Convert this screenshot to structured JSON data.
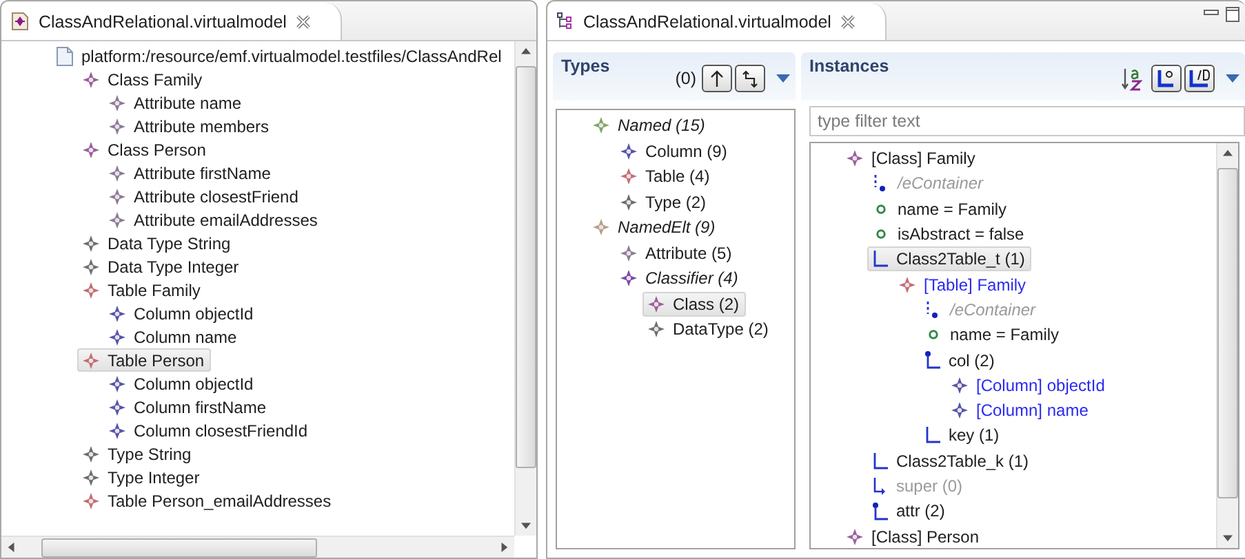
{
  "model_editor": {
    "tab": {
      "title": "ClassAndRelational.virtualmodel"
    },
    "tree": [
      {
        "label": "platform:/resource/emf.virtualmodel.testfiles/ClassAndRel",
        "kind": "resource",
        "selected": false,
        "children": [
          {
            "label": "Class Family",
            "kind": "class",
            "selected": false,
            "children": [
              {
                "label": "Attribute name",
                "kind": "attribute",
                "selected": false
              },
              {
                "label": "Attribute members",
                "kind": "attribute",
                "selected": false
              }
            ]
          },
          {
            "label": "Class Person",
            "kind": "class",
            "selected": false,
            "children": [
              {
                "label": "Attribute firstName",
                "kind": "attribute",
                "selected": false
              },
              {
                "label": "Attribute closestFriend",
                "kind": "attribute",
                "selected": false
              },
              {
                "label": "Attribute emailAddresses",
                "kind": "attribute",
                "selected": false
              }
            ]
          },
          {
            "label": "Data Type String",
            "kind": "datatype",
            "selected": false
          },
          {
            "label": "Data Type Integer",
            "kind": "datatype",
            "selected": false
          },
          {
            "label": "Table Family",
            "kind": "table",
            "selected": false,
            "children": [
              {
                "label": "Column objectId",
                "kind": "column",
                "selected": false
              },
              {
                "label": "Column name",
                "kind": "column",
                "selected": false
              }
            ]
          },
          {
            "label": "Table Person",
            "kind": "table",
            "selected": true,
            "children": [
              {
                "label": "Column objectId",
                "kind": "column",
                "selected": false
              },
              {
                "label": "Column firstName",
                "kind": "column",
                "selected": false
              },
              {
                "label": "Column closestFriendId",
                "kind": "column",
                "selected": false
              }
            ]
          },
          {
            "label": "Type String",
            "kind": "type",
            "selected": false
          },
          {
            "label": "Type Integer",
            "kind": "type",
            "selected": false
          },
          {
            "label": "Table Person_emailAddresses",
            "kind": "table",
            "selected": false
          }
        ]
      }
    ]
  },
  "virtual_model_view": {
    "tab": {
      "title": "ClassAndRelational.virtualmodel"
    },
    "types": {
      "title": "Types",
      "count": "(0)",
      "tree": [
        {
          "label": "Named (15)",
          "kind": "named",
          "abstract": true,
          "selected": false,
          "children": [
            {
              "label": "Column (9)",
              "kind": "column",
              "abstract": false,
              "selected": false
            },
            {
              "label": "Table (4)",
              "kind": "table",
              "abstract": false,
              "selected": false
            },
            {
              "label": "Type (2)",
              "kind": "type",
              "abstract": false,
              "selected": false
            }
          ]
        },
        {
          "label": "NamedElt (9)",
          "kind": "namedelt",
          "abstract": true,
          "selected": false,
          "children": [
            {
              "label": "Attribute (5)",
              "kind": "attribute",
              "abstract": false,
              "selected": false
            },
            {
              "label": "Classifier (4)",
              "kind": "classifier",
              "abstract": true,
              "selected": false,
              "children": [
                {
                  "label": "Class (2)",
                  "kind": "class",
                  "abstract": false,
                  "selected": true
                },
                {
                  "label": "DataType (2)",
                  "kind": "datatype",
                  "abstract": false,
                  "selected": false
                }
              ]
            }
          ]
        }
      ]
    },
    "instances": {
      "title": "Instances",
      "filter": {
        "placeholder": "type filter text"
      },
      "tree": [
        {
          "label": "[Class] Family",
          "kind": "class",
          "linked": false,
          "selected": false,
          "children": [
            {
              "label": "/eContainer",
              "kind": "derived",
              "selected": false
            },
            {
              "label": "name = Family",
              "kind": "attribute-value",
              "selected": false
            },
            {
              "label": "isAbstract = false",
              "kind": "attribute-value",
              "selected": false
            },
            {
              "label": "Class2Table_t (1)",
              "kind": "reference",
              "selected": true,
              "children": [
                {
                  "label": "[Table] Family",
                  "kind": "table",
                  "linked": true,
                  "selected": false,
                  "children": [
                    {
                      "label": "/eContainer",
                      "kind": "derived",
                      "selected": false
                    },
                    {
                      "label": "name = Family",
                      "kind": "attribute-value",
                      "selected": false
                    },
                    {
                      "label": "col (2)",
                      "kind": "containment",
                      "selected": false,
                      "children": [
                        {
                          "label": "[Column] objectId",
                          "kind": "column",
                          "linked": true,
                          "selected": false
                        },
                        {
                          "label": "[Column] name",
                          "kind": "column",
                          "linked": true,
                          "selected": false
                        }
                      ]
                    },
                    {
                      "label": "key (1)",
                      "kind": "reference",
                      "selected": false
                    }
                  ]
                }
              ]
            },
            {
              "label": "Class2Table_k (1)",
              "kind": "reference",
              "selected": false
            },
            {
              "label": "super (0)",
              "kind": "empty-reference",
              "selected": false
            },
            {
              "label": "attr (2)",
              "kind": "containment",
              "selected": false
            }
          ]
        },
        {
          "label": "[Class] Person",
          "kind": "class",
          "linked": false,
          "selected": false
        }
      ]
    }
  }
}
